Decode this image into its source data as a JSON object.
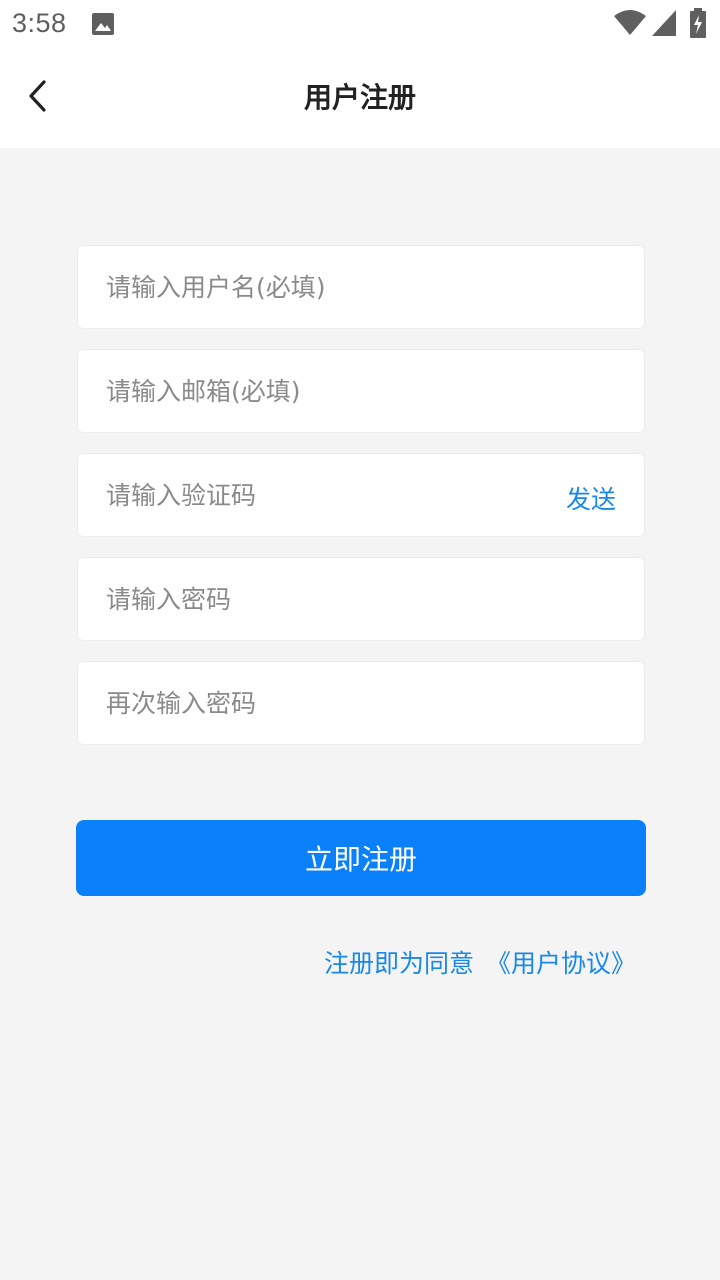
{
  "status_bar": {
    "time": "3:58",
    "icons": [
      "image-icon",
      "wifi-icon",
      "signal-icon",
      "battery-charging-icon"
    ]
  },
  "header": {
    "back_icon": "chevron-left-icon",
    "title": "用户注册"
  },
  "form": {
    "username": {
      "value": "",
      "placeholder": "请输入用户名(必填)"
    },
    "email": {
      "value": "",
      "placeholder": "请输入邮箱(必填)"
    },
    "code": {
      "value": "",
      "placeholder": "请输入验证码",
      "send_label": "发送"
    },
    "password": {
      "value": "",
      "placeholder": "请输入密码"
    },
    "password_confirm": {
      "value": "",
      "placeholder": "再次输入密码"
    }
  },
  "register_button": {
    "label": "立即注册"
  },
  "agreement": {
    "prefix": "注册即为同意",
    "link": "《用户协议》"
  },
  "colors": {
    "accent": "#0a80fb",
    "link": "#1a88e8",
    "background": "#f4f4f4"
  }
}
